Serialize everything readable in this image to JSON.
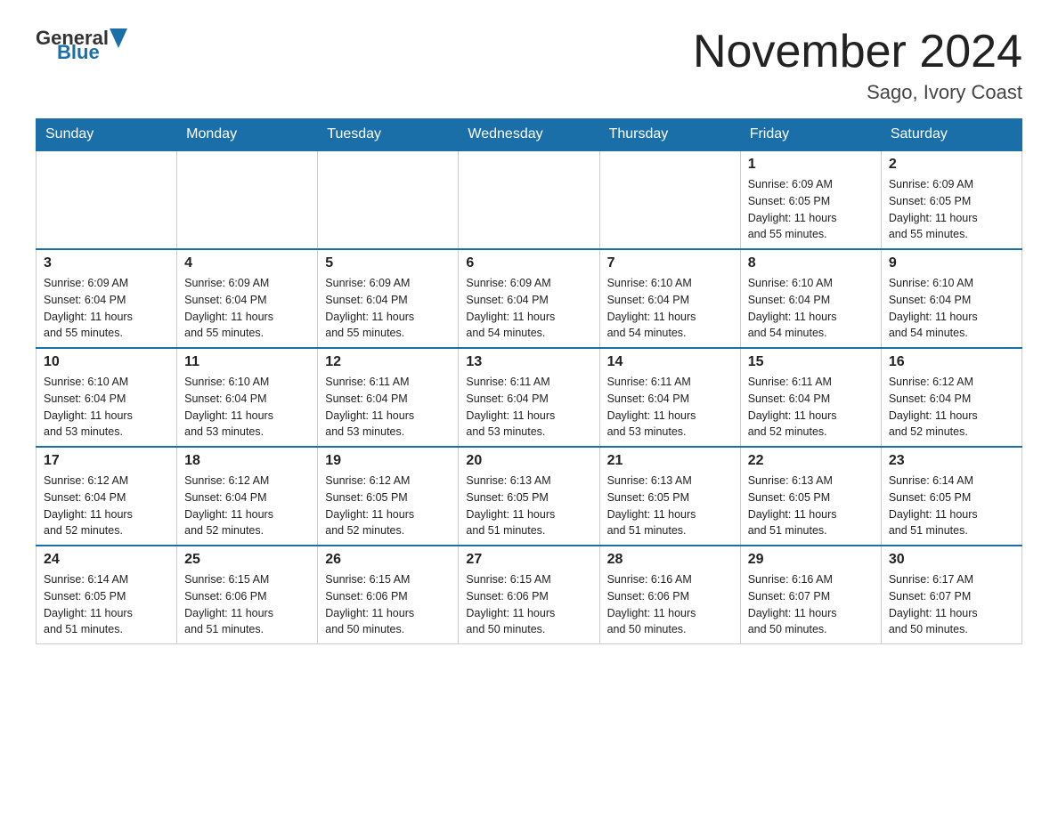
{
  "header": {
    "logo_general": "General",
    "logo_blue": "Blue",
    "month_year": "November 2024",
    "location": "Sago, Ivory Coast"
  },
  "weekdays": [
    "Sunday",
    "Monday",
    "Tuesday",
    "Wednesday",
    "Thursday",
    "Friday",
    "Saturday"
  ],
  "weeks": [
    [
      {
        "day": "",
        "info": ""
      },
      {
        "day": "",
        "info": ""
      },
      {
        "day": "",
        "info": ""
      },
      {
        "day": "",
        "info": ""
      },
      {
        "day": "",
        "info": ""
      },
      {
        "day": "1",
        "info": "Sunrise: 6:09 AM\nSunset: 6:05 PM\nDaylight: 11 hours\nand 55 minutes."
      },
      {
        "day": "2",
        "info": "Sunrise: 6:09 AM\nSunset: 6:05 PM\nDaylight: 11 hours\nand 55 minutes."
      }
    ],
    [
      {
        "day": "3",
        "info": "Sunrise: 6:09 AM\nSunset: 6:04 PM\nDaylight: 11 hours\nand 55 minutes."
      },
      {
        "day": "4",
        "info": "Sunrise: 6:09 AM\nSunset: 6:04 PM\nDaylight: 11 hours\nand 55 minutes."
      },
      {
        "day": "5",
        "info": "Sunrise: 6:09 AM\nSunset: 6:04 PM\nDaylight: 11 hours\nand 55 minutes."
      },
      {
        "day": "6",
        "info": "Sunrise: 6:09 AM\nSunset: 6:04 PM\nDaylight: 11 hours\nand 54 minutes."
      },
      {
        "day": "7",
        "info": "Sunrise: 6:10 AM\nSunset: 6:04 PM\nDaylight: 11 hours\nand 54 minutes."
      },
      {
        "day": "8",
        "info": "Sunrise: 6:10 AM\nSunset: 6:04 PM\nDaylight: 11 hours\nand 54 minutes."
      },
      {
        "day": "9",
        "info": "Sunrise: 6:10 AM\nSunset: 6:04 PM\nDaylight: 11 hours\nand 54 minutes."
      }
    ],
    [
      {
        "day": "10",
        "info": "Sunrise: 6:10 AM\nSunset: 6:04 PM\nDaylight: 11 hours\nand 53 minutes."
      },
      {
        "day": "11",
        "info": "Sunrise: 6:10 AM\nSunset: 6:04 PM\nDaylight: 11 hours\nand 53 minutes."
      },
      {
        "day": "12",
        "info": "Sunrise: 6:11 AM\nSunset: 6:04 PM\nDaylight: 11 hours\nand 53 minutes."
      },
      {
        "day": "13",
        "info": "Sunrise: 6:11 AM\nSunset: 6:04 PM\nDaylight: 11 hours\nand 53 minutes."
      },
      {
        "day": "14",
        "info": "Sunrise: 6:11 AM\nSunset: 6:04 PM\nDaylight: 11 hours\nand 53 minutes."
      },
      {
        "day": "15",
        "info": "Sunrise: 6:11 AM\nSunset: 6:04 PM\nDaylight: 11 hours\nand 52 minutes."
      },
      {
        "day": "16",
        "info": "Sunrise: 6:12 AM\nSunset: 6:04 PM\nDaylight: 11 hours\nand 52 minutes."
      }
    ],
    [
      {
        "day": "17",
        "info": "Sunrise: 6:12 AM\nSunset: 6:04 PM\nDaylight: 11 hours\nand 52 minutes."
      },
      {
        "day": "18",
        "info": "Sunrise: 6:12 AM\nSunset: 6:04 PM\nDaylight: 11 hours\nand 52 minutes."
      },
      {
        "day": "19",
        "info": "Sunrise: 6:12 AM\nSunset: 6:05 PM\nDaylight: 11 hours\nand 52 minutes."
      },
      {
        "day": "20",
        "info": "Sunrise: 6:13 AM\nSunset: 6:05 PM\nDaylight: 11 hours\nand 51 minutes."
      },
      {
        "day": "21",
        "info": "Sunrise: 6:13 AM\nSunset: 6:05 PM\nDaylight: 11 hours\nand 51 minutes."
      },
      {
        "day": "22",
        "info": "Sunrise: 6:13 AM\nSunset: 6:05 PM\nDaylight: 11 hours\nand 51 minutes."
      },
      {
        "day": "23",
        "info": "Sunrise: 6:14 AM\nSunset: 6:05 PM\nDaylight: 11 hours\nand 51 minutes."
      }
    ],
    [
      {
        "day": "24",
        "info": "Sunrise: 6:14 AM\nSunset: 6:05 PM\nDaylight: 11 hours\nand 51 minutes."
      },
      {
        "day": "25",
        "info": "Sunrise: 6:15 AM\nSunset: 6:06 PM\nDaylight: 11 hours\nand 51 minutes."
      },
      {
        "day": "26",
        "info": "Sunrise: 6:15 AM\nSunset: 6:06 PM\nDaylight: 11 hours\nand 50 minutes."
      },
      {
        "day": "27",
        "info": "Sunrise: 6:15 AM\nSunset: 6:06 PM\nDaylight: 11 hours\nand 50 minutes."
      },
      {
        "day": "28",
        "info": "Sunrise: 6:16 AM\nSunset: 6:06 PM\nDaylight: 11 hours\nand 50 minutes."
      },
      {
        "day": "29",
        "info": "Sunrise: 6:16 AM\nSunset: 6:07 PM\nDaylight: 11 hours\nand 50 minutes."
      },
      {
        "day": "30",
        "info": "Sunrise: 6:17 AM\nSunset: 6:07 PM\nDaylight: 11 hours\nand 50 minutes."
      }
    ]
  ]
}
